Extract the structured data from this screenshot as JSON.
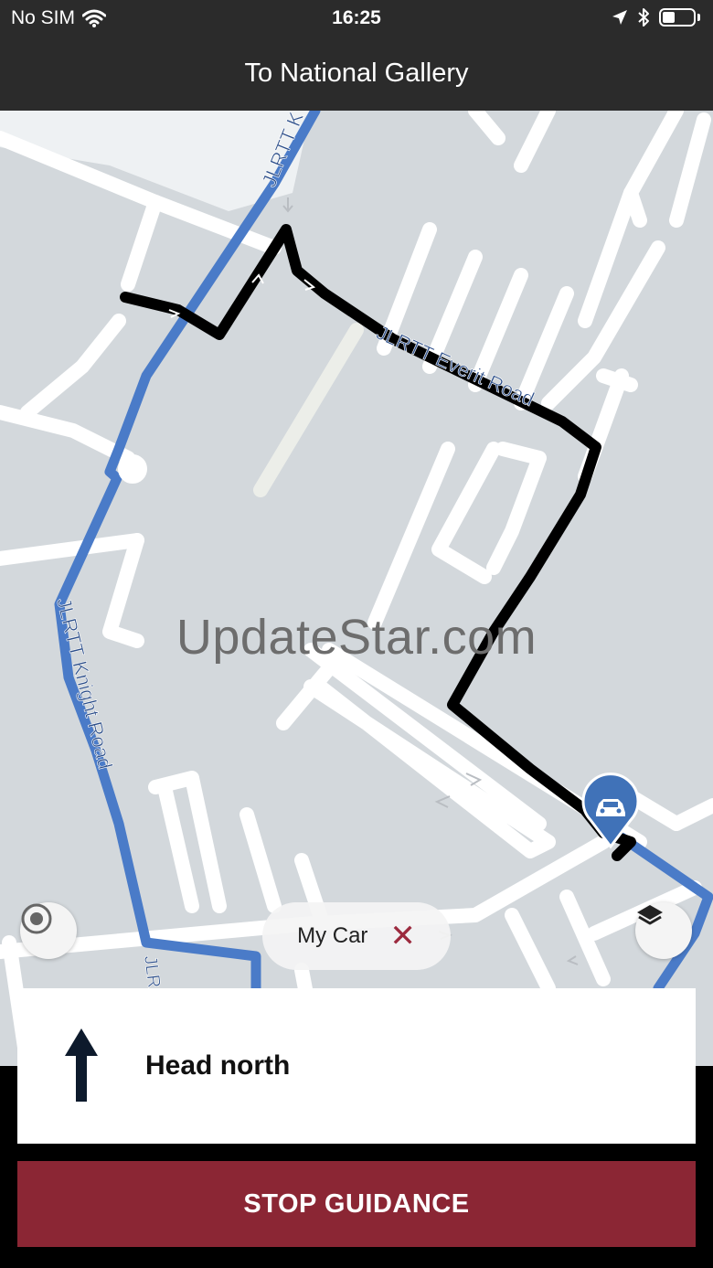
{
  "status": {
    "carrier": "No SIM",
    "time": "16:25",
    "battery_level": 0.4
  },
  "header": {
    "title": "To National Gallery"
  },
  "map": {
    "roads": {
      "top_road": "JLRTT K",
      "everit_road": "JLRTT Everit Road",
      "knight_road": "JLRTT Knight Road",
      "bottom_road": "JLR"
    },
    "watermark": "UpdateStar.com",
    "chip": {
      "label": "My Car",
      "close_glyph": "✕"
    },
    "icons": {
      "locate": "locate-icon",
      "layers": "layers-icon",
      "car_marker": "car-icon"
    }
  },
  "instruction": {
    "text": "Head north",
    "icon": "arrow-up-icon"
  },
  "actions": {
    "stop_label": "STOP GUIDANCE"
  },
  "colors": {
    "header_bg": "#2b2b2b",
    "route": "#000000",
    "blue_road": "#4a7bc8",
    "stop_button": "#8b2634",
    "map_bg": "#d3d8dc"
  }
}
